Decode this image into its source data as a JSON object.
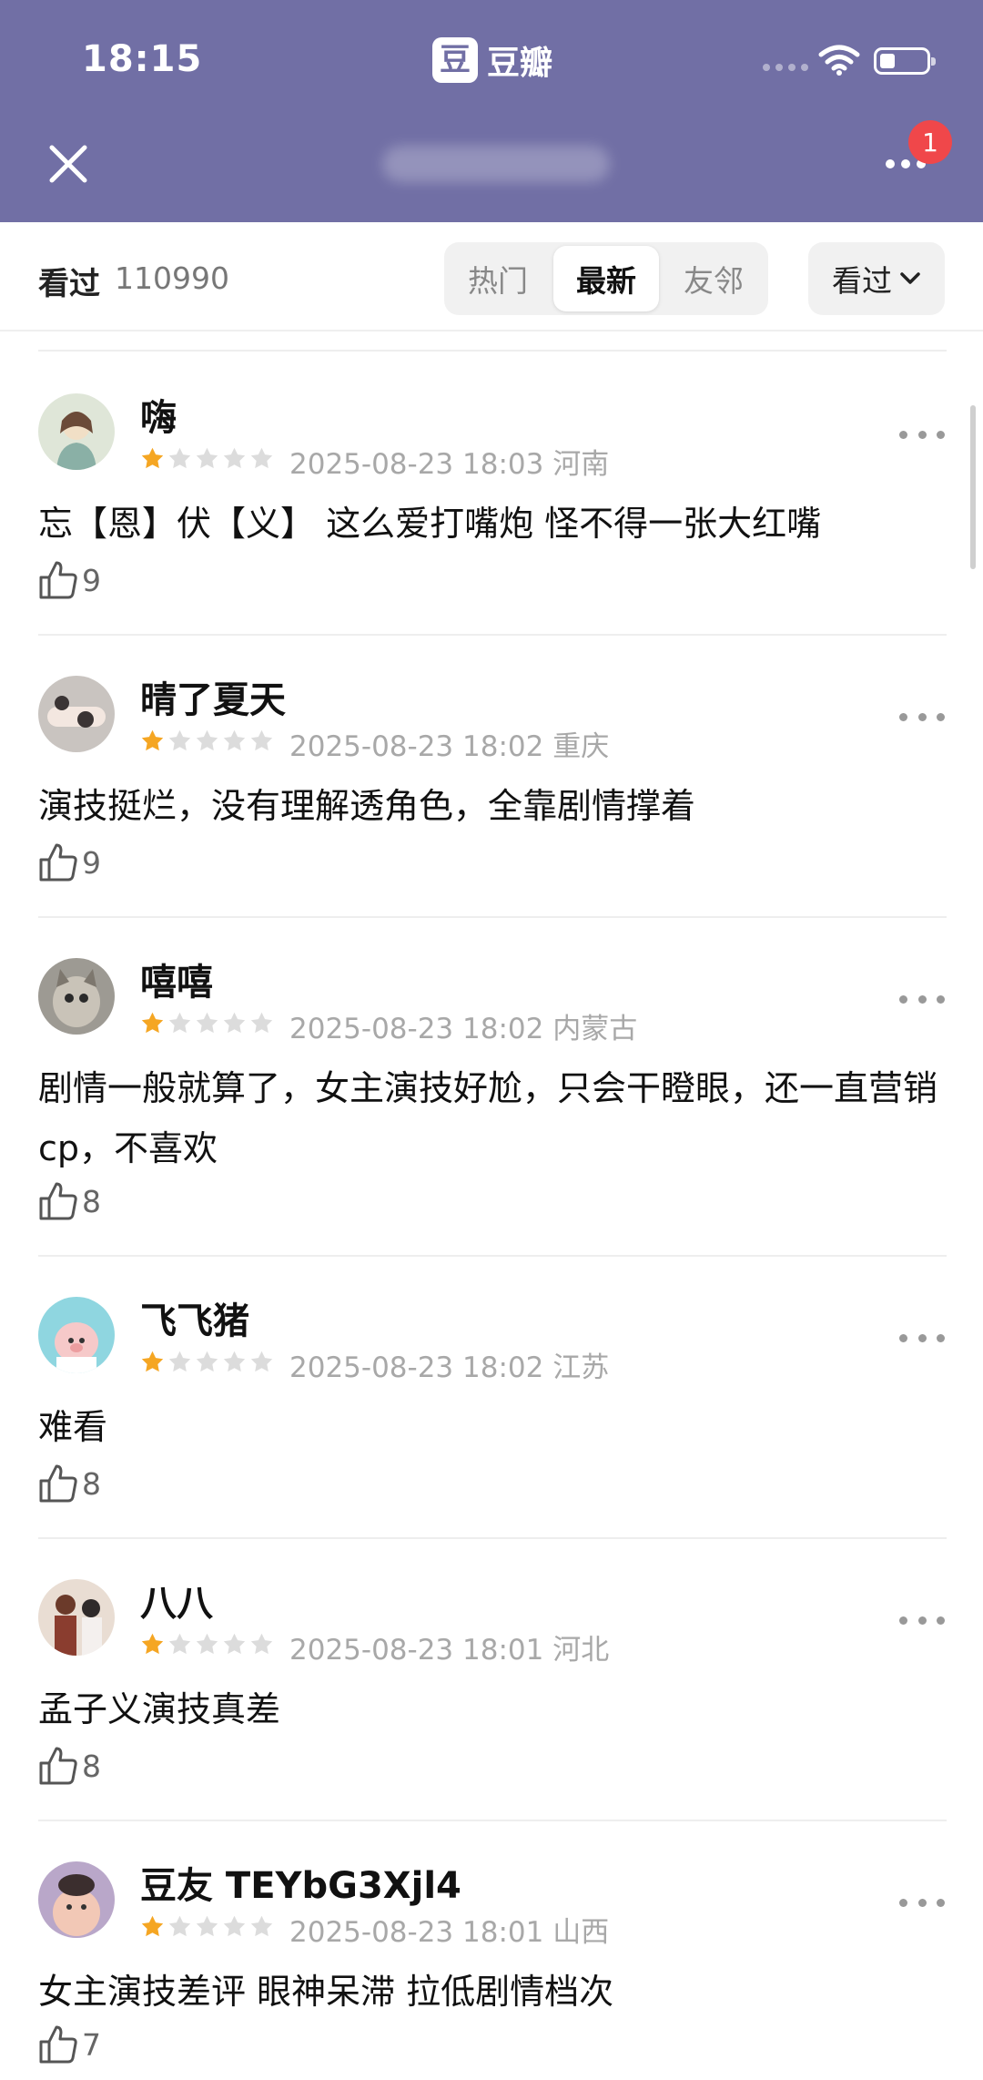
{
  "status_bar": {
    "time": "18:15"
  },
  "app": {
    "logo_char": "豆",
    "name": "豆瓣",
    "badge_count": "1"
  },
  "filter_bar": {
    "watched_label": "看过",
    "watched_count": "110990",
    "tabs": [
      "热门",
      "最新",
      "友邻"
    ],
    "active_tab": "最新",
    "dropdown_label": "看过"
  },
  "colors": {
    "header": "#716fa5",
    "star_filled": "#f5a623",
    "star_empty": "#dcdcdc",
    "badge": "#f0474a"
  },
  "comments": [
    {
      "user": "嗨",
      "rating": 1,
      "time": "2025-08-23 18:03",
      "location": "河南",
      "text": "忘【恩】伏【义】   这么爱打嘴炮  怪不得一张大红嘴",
      "likes": "9"
    },
    {
      "user": "晴了夏天",
      "rating": 1,
      "time": "2025-08-23 18:02",
      "location": "重庆",
      "text": "演技挺烂，没有理解透角色，全靠剧情撑着",
      "likes": "9"
    },
    {
      "user": "嘻嘻",
      "rating": 1,
      "time": "2025-08-23 18:02",
      "location": "内蒙古",
      "text": "剧情一般就算了，女主演技好尬，只会干瞪眼，还一直营销cp，不喜欢",
      "likes": "8"
    },
    {
      "user": "飞飞猪",
      "rating": 1,
      "time": "2025-08-23 18:02",
      "location": "江苏",
      "text": "难看",
      "likes": "8"
    },
    {
      "user": "八八",
      "rating": 1,
      "time": "2025-08-23 18:01",
      "location": "河北",
      "text": "孟子义演技真差",
      "likes": "8"
    },
    {
      "user": "豆友 TEYbG3Xjl4",
      "rating": 1,
      "time": "2025-08-23 18:01",
      "location": "山西",
      "text": "女主演技差评 眼神呆滞 拉低剧情档次",
      "likes": "7"
    }
  ]
}
